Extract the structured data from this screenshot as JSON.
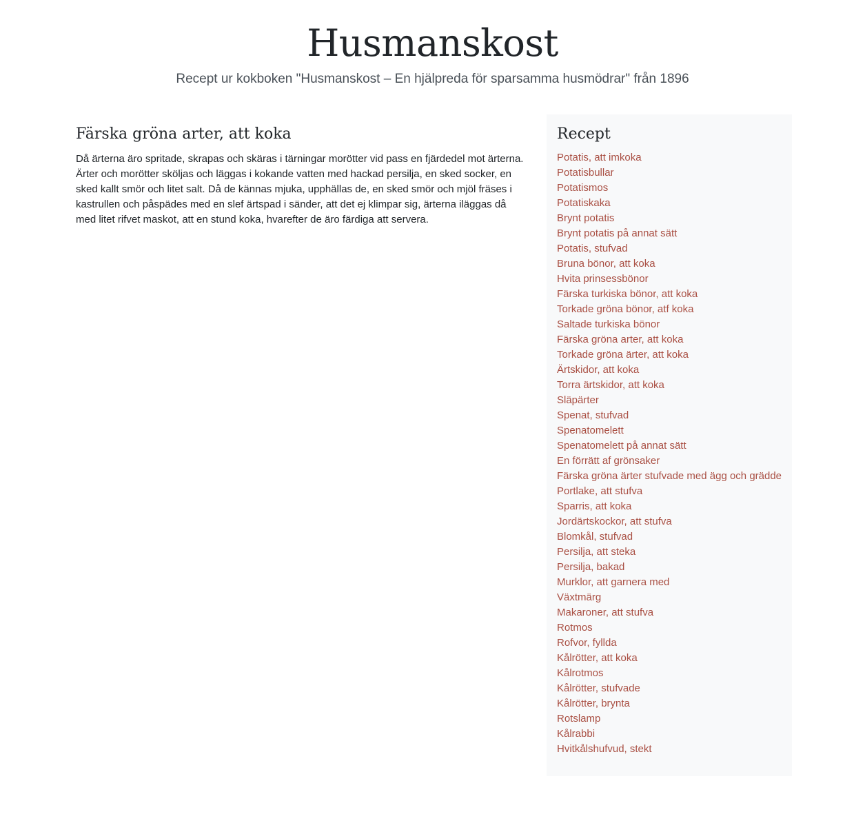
{
  "header": {
    "title": "Husmanskost",
    "subtitle": "Recept ur kokboken \"Husmanskost – En hjälpreda för sparsamma husmödrar\" från 1896"
  },
  "main": {
    "recipe_title": "Färska gröna arter, att koka",
    "recipe_text": "Då ärterna äro spritade, skrapas och skäras i tärningar morötter vid pass en fjärdedel mot ärterna. Ärter och morötter sköljas och läggas i kokande vatten med hackad persilja, en sked socker, en sked kallt smör och litet salt. Då de kännas mjuka, upphällas de, en sked smör och mjöl fräses i kastrullen och påspädes med en slef ärtspad i sänder, att det ej klimpar sig, ärterna iläggas då med litet rifvet maskot, att en stund koka, hvarefter de äro färdiga att servera."
  },
  "sidebar": {
    "title": "Recept",
    "link_color": "#a94f43",
    "items": [
      "Potatis, att imkoka",
      "Potatisbullar",
      "Potatismos",
      "Potatiskaka",
      "Brynt potatis",
      "Brynt potatis på annat sätt",
      "Potatis, stufvad",
      "Bruna bönor, att koka",
      "Hvita prinsessbönor",
      "Färska turkiska bönor, att koka",
      "Torkade gröna bönor, atf koka",
      "Saltade turkiska bönor",
      "Färska gröna arter, att koka",
      "Torkade gröna ärter, att koka",
      "Ärtskidor, att koka",
      "Torra ärtskidor, att koka",
      "Släpärter",
      "Spenat, stufvad",
      "Spenatomelett",
      "Spenatomelett på annat sätt",
      "En förrätt af grönsaker",
      "Färska gröna ärter stufvade med ägg och grädde",
      "Portlake, att stufva",
      "Sparris, att koka",
      "Jordärtskockor, att stufva",
      "Blomkål, stufvad",
      "Persilja, att steka",
      "Persilja, bakad",
      "Murklor, att garnera med",
      "Växtmärg",
      "Makaroner, att stufva",
      "Rotmos",
      "Rofvor, fyllda",
      "Kålrötter, att koka",
      "Kålrotmos",
      "Kålrötter, stufvade",
      "Kålrötter, brynta",
      "Rotslamp",
      "Kålrabbi",
      "Hvitkålshufvud, stekt"
    ]
  }
}
